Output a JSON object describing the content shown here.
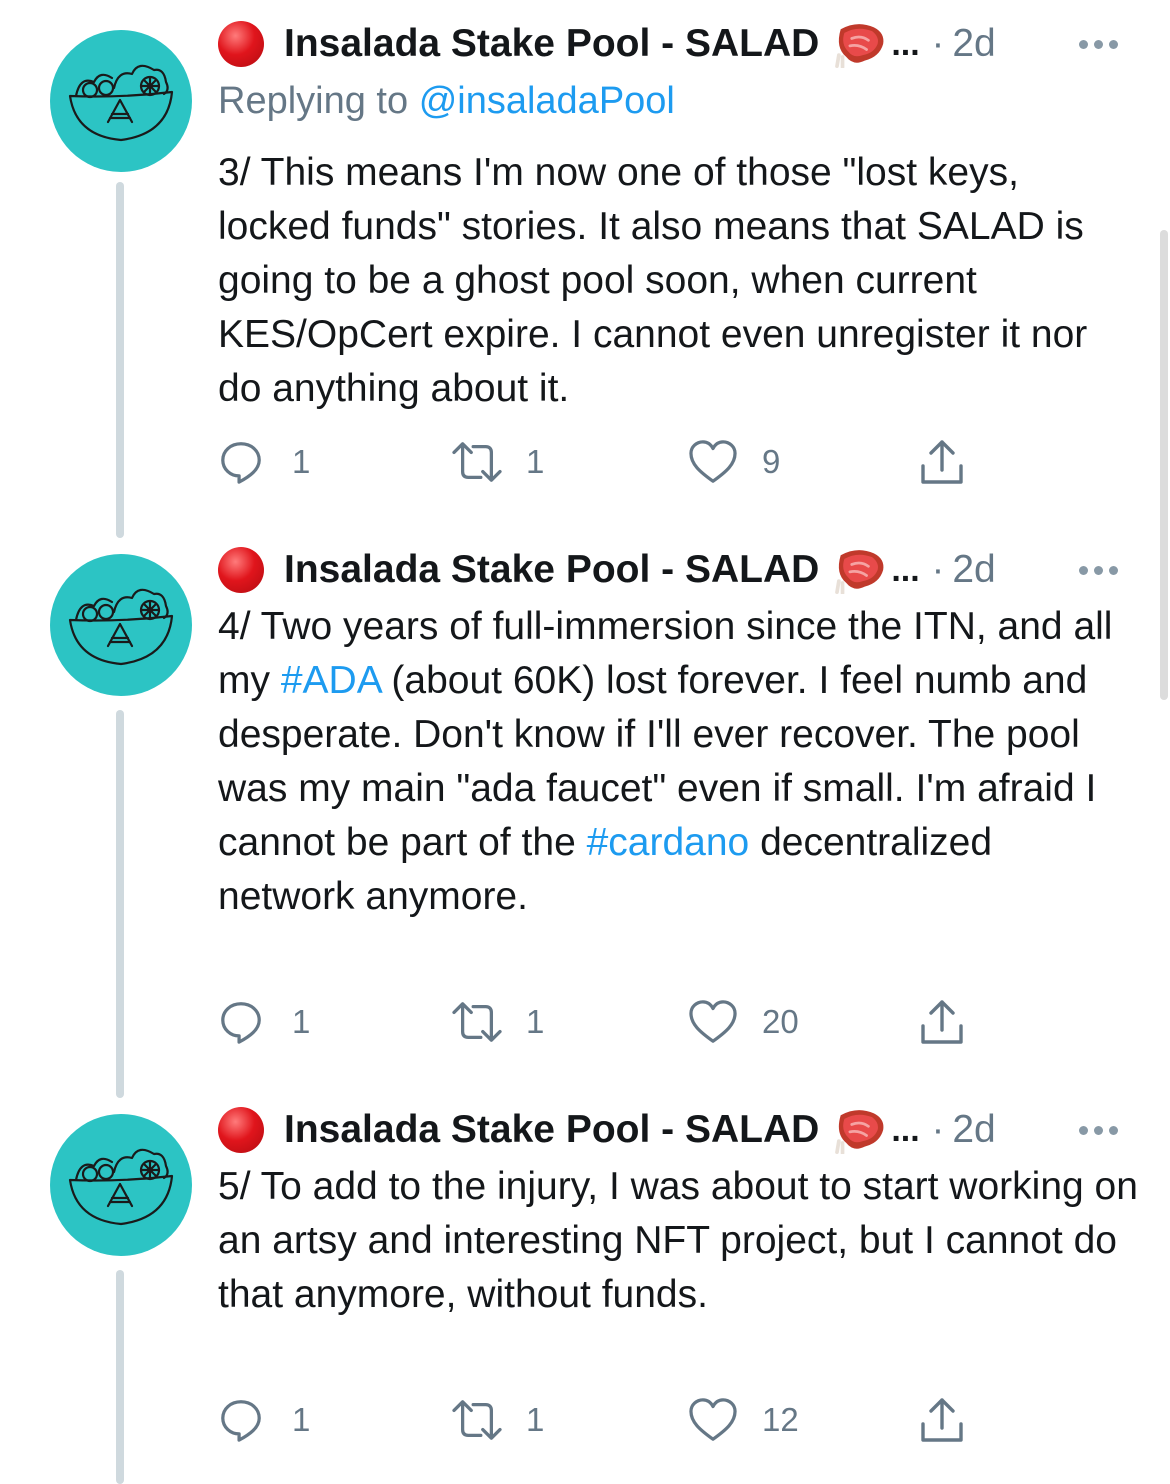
{
  "colors": {
    "avatar_bg": "#2cc4c4",
    "link": "#1d9bf0",
    "muted": "#657786",
    "status_dot": "#e0151c",
    "thread_line": "#cfd9de"
  },
  "icons": [
    "red-circle-status-icon",
    "steak-emoji-icon",
    "more-options-icon",
    "reply-icon",
    "retweet-icon",
    "like-icon",
    "share-icon"
  ],
  "tweets": [
    {
      "name": "Insalada Stake Pool - SALAD",
      "ellipsis": "...",
      "separator": "·",
      "time": "2d",
      "replying_prefix": "Replying to",
      "replying_handle": "@insaladaPool",
      "text": "3/ This means I'm now one of those \"lost keys, locked funds\" stories. It also means that SALAD is going to be a ghost pool soon, when current KES/OpCert expire. I cannot even unregister it nor do anything about it.",
      "replies": "1",
      "retweets": "1",
      "likes": "9"
    },
    {
      "name": "Insalada Stake Pool - SALAD",
      "ellipsis": "...",
      "separator": "·",
      "time": "2d",
      "text_1": "4/ Two years of full-immersion since the ITN, and all my ",
      "hashtag_1": "#ADA",
      "text_2": " (about 60K) lost forever. I feel numb and desperate. Don't know if I'll ever recover. The pool was my main \"ada faucet\" even if small. I'm afraid I cannot be part of the ",
      "hashtag_2": "#cardano",
      "text_3": " decentralized network anymore.",
      "replies": "1",
      "retweets": "1",
      "likes": "20"
    },
    {
      "name": "Insalada Stake Pool - SALAD",
      "ellipsis": "...",
      "separator": "·",
      "time": "2d",
      "text": "5/ To add to the injury, I was about to start working on an artsy and interesting NFT project, but I cannot do that anymore, without funds.",
      "replies": "1",
      "retweets": "1",
      "likes": "12"
    }
  ]
}
